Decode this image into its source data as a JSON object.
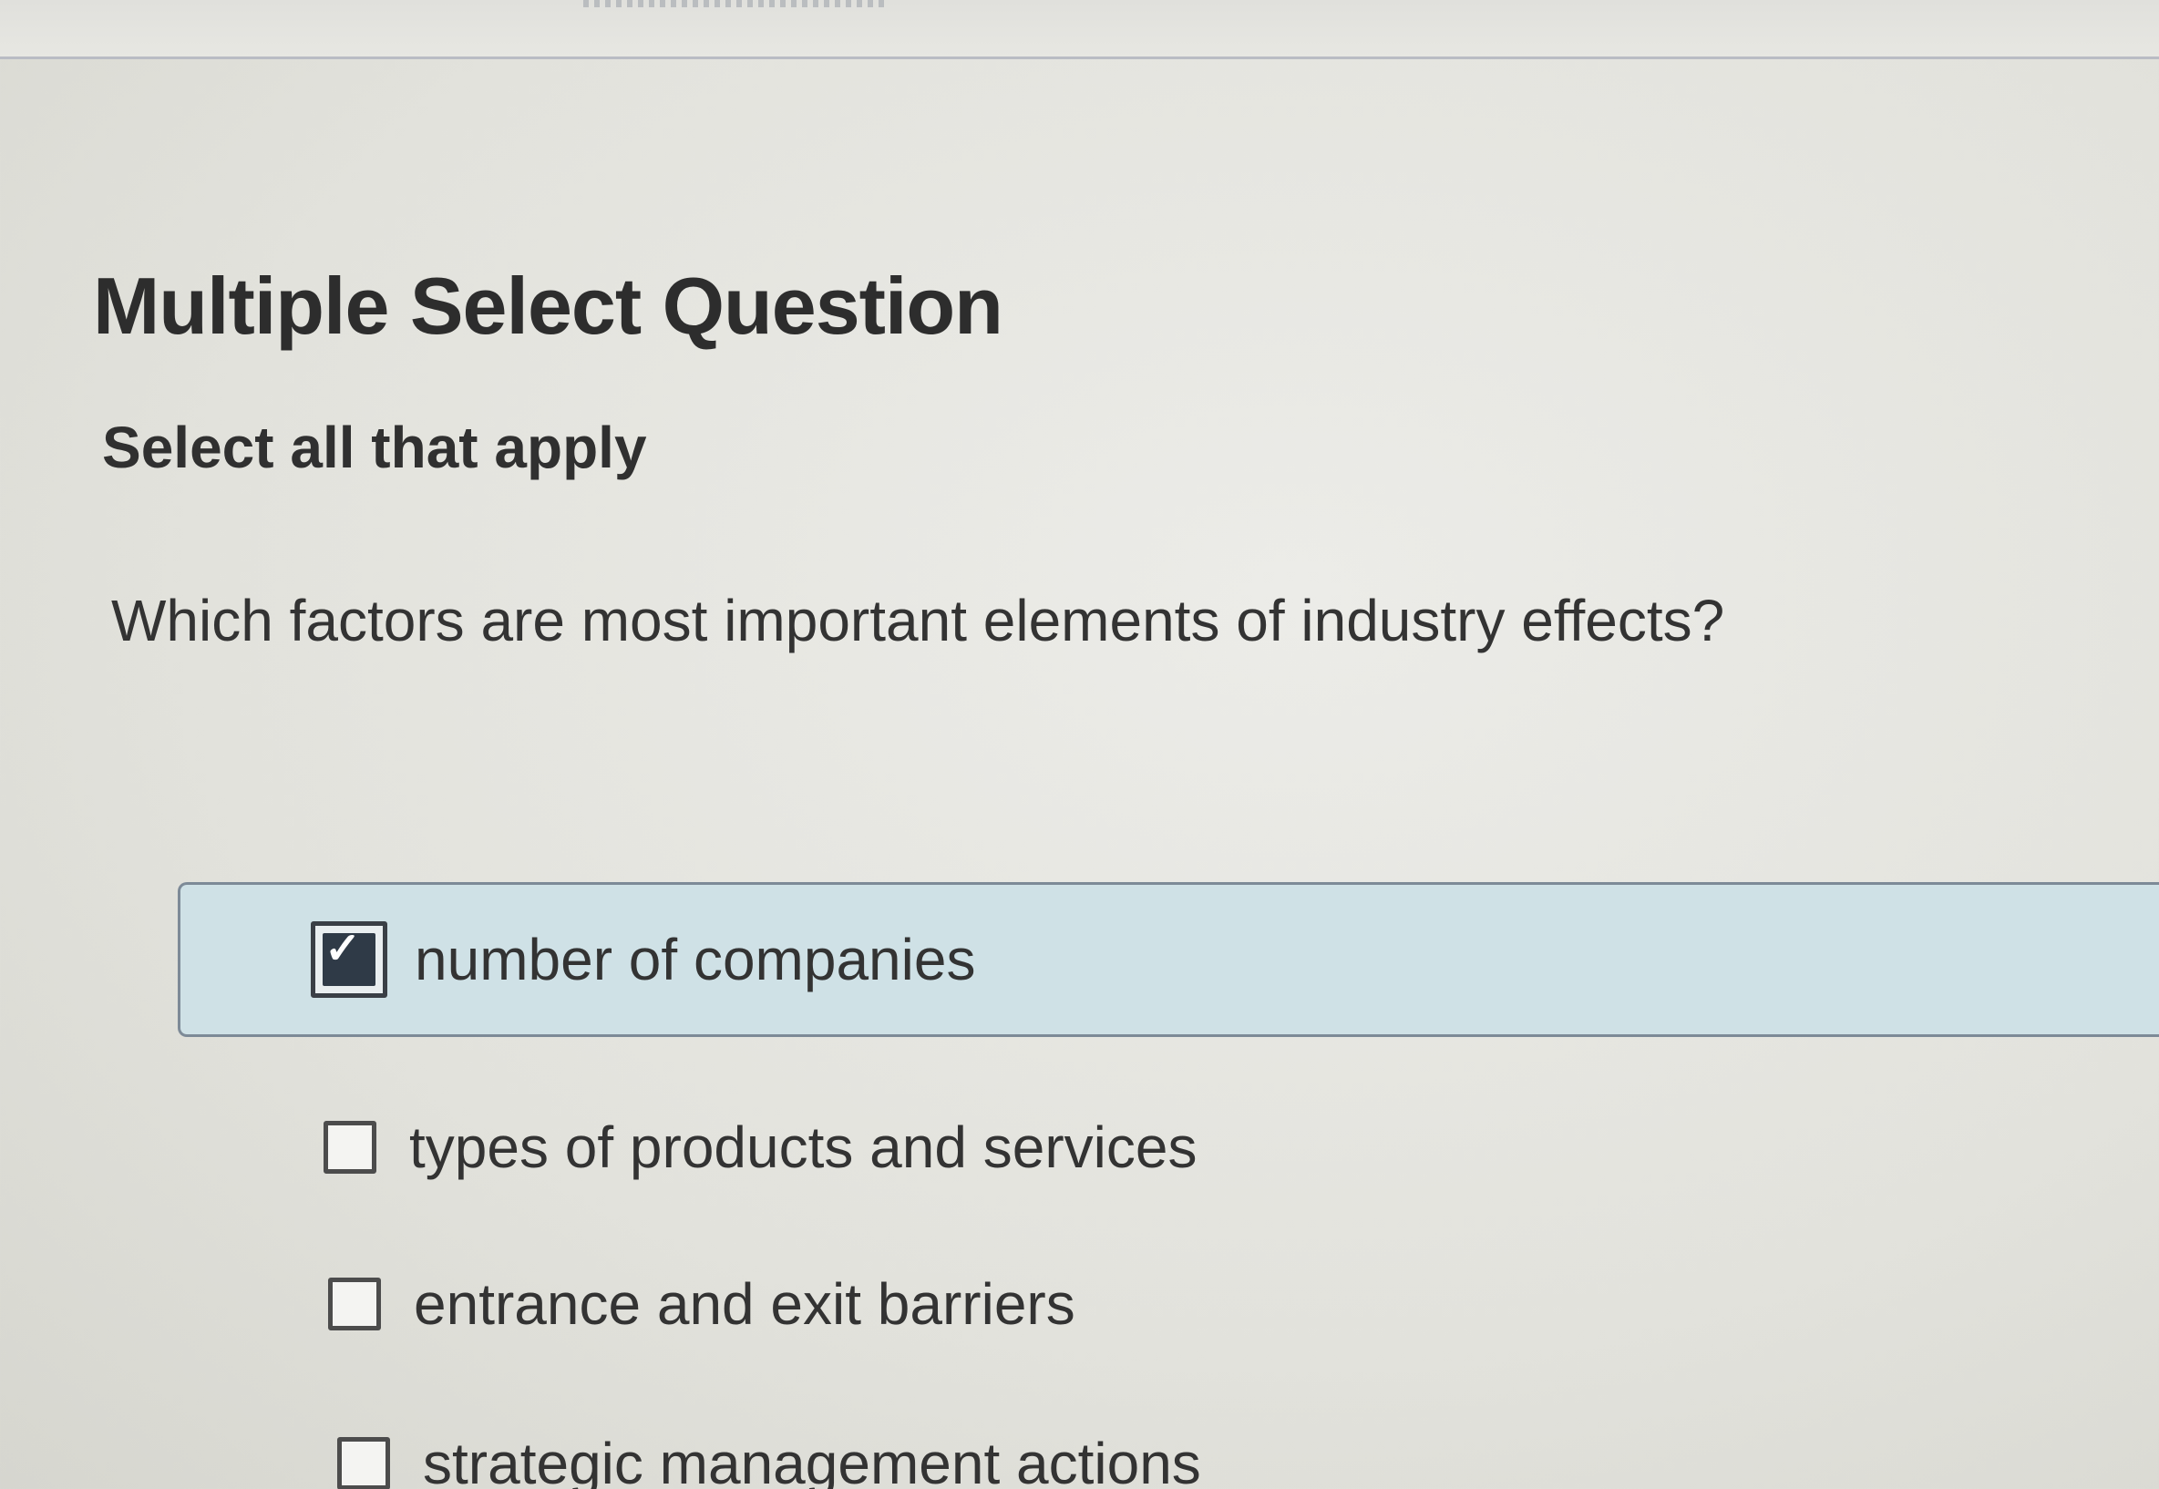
{
  "question": {
    "type_title": "Multiple Select Question",
    "instruction": "Select all that apply",
    "prompt": "Which factors are most important elements of industry effects?"
  },
  "options": [
    {
      "label": "number of companies",
      "checked": true
    },
    {
      "label": "types of products and services",
      "checked": false
    },
    {
      "label": "entrance and exit barriers",
      "checked": false
    },
    {
      "label": "strategic management actions",
      "checked": false
    }
  ],
  "colors": {
    "selected_background": "#cfe1e6",
    "checkbox_checked": "#2f3a47"
  },
  "icons": {
    "checked": "checkbox-checked-icon",
    "unchecked": "checkbox-unchecked-icon"
  }
}
